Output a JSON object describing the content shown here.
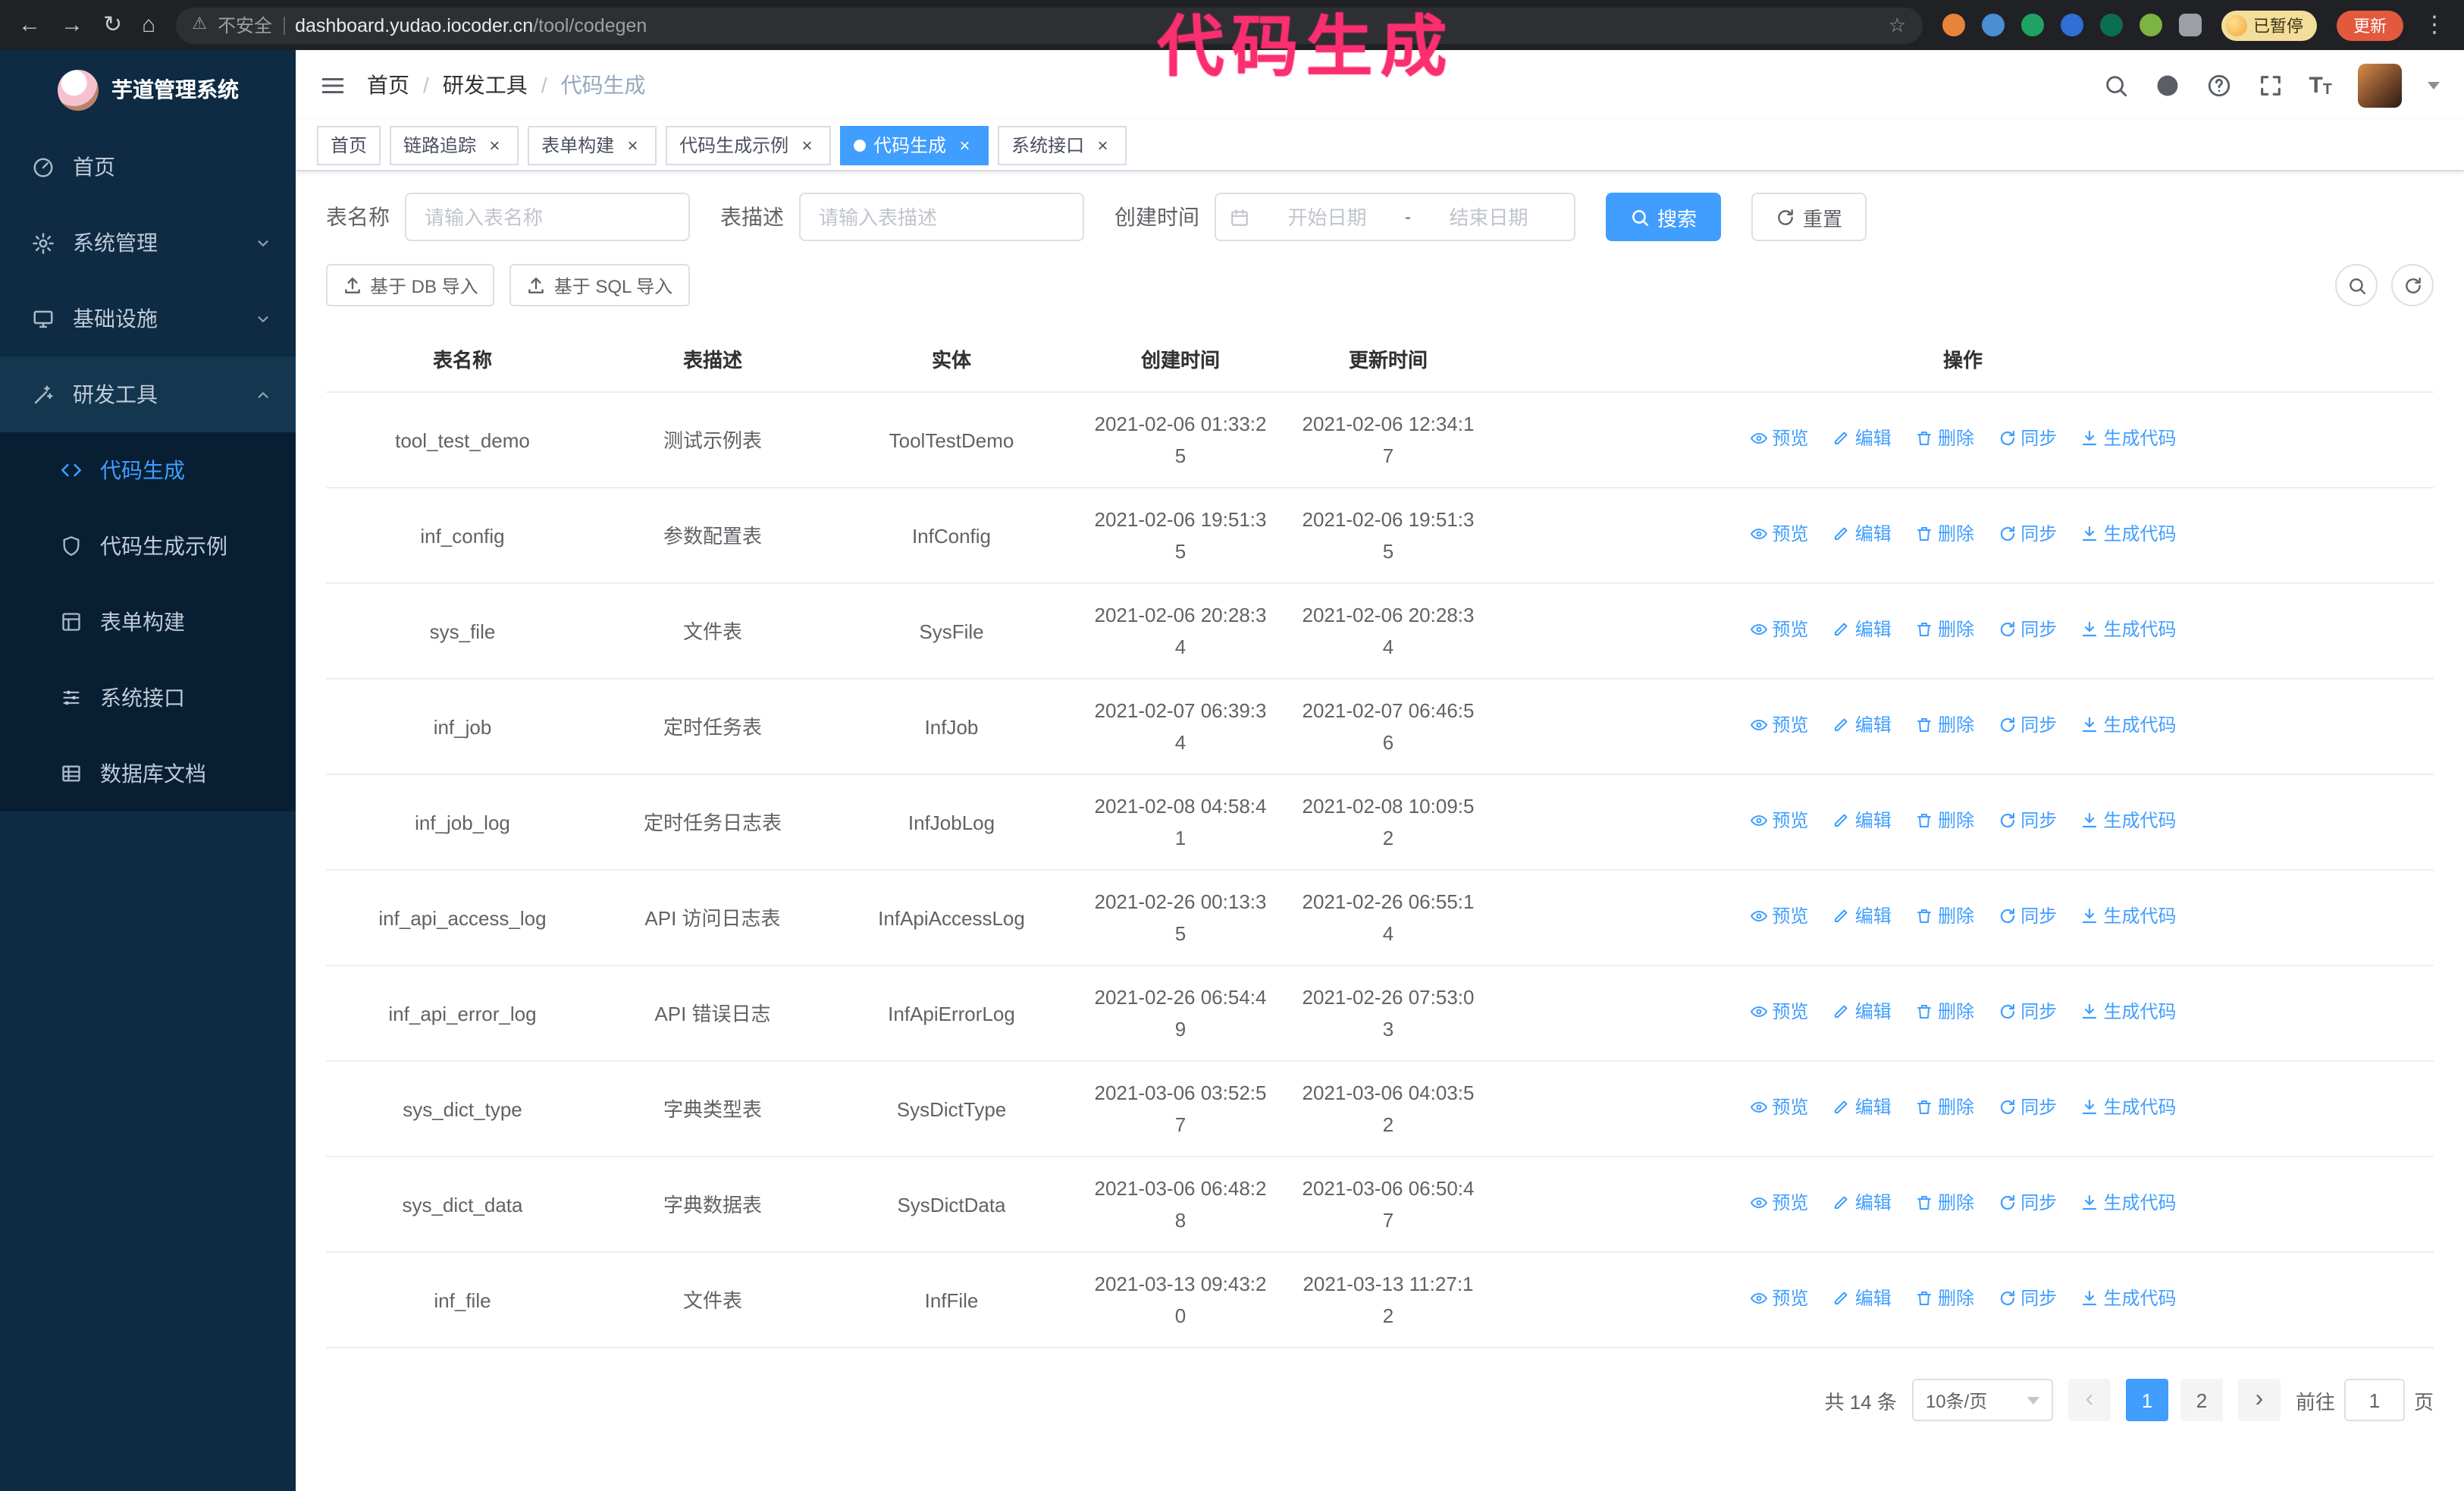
{
  "annotation": {
    "label": "代码生成"
  },
  "icons": {
    "back": "←",
    "forward": "→",
    "reload": "↻",
    "home": "⌂",
    "warning": "⚠",
    "star": "☆",
    "more": "⋮",
    "close": "×",
    "slash": "/",
    "prev": "‹",
    "next": "›",
    "letter_t": "T"
  },
  "browser": {
    "security_label": "不安全",
    "url_host": "dashboard.yudao.iocoder.cn",
    "url_path": "/tool/codegen",
    "profile_badge": "已暂停",
    "update_button": "更新"
  },
  "sidebar": {
    "app_title": "芋道管理系统",
    "items": [
      {
        "label": "首页"
      },
      {
        "label": "系统管理"
      },
      {
        "label": "基础设施"
      },
      {
        "label": "研发工具",
        "expanded": true
      }
    ],
    "submenu": [
      {
        "label": "代码生成",
        "active": true
      },
      {
        "label": "代码生成示例"
      },
      {
        "label": "表单构建"
      },
      {
        "label": "系统接口"
      },
      {
        "label": "数据库文档"
      }
    ]
  },
  "header": {
    "breadcrumb": [
      "首页",
      "研发工具",
      "代码生成"
    ]
  },
  "tabs": [
    {
      "label": "首页",
      "closable": false
    },
    {
      "label": "链路追踪",
      "closable": true
    },
    {
      "label": "表单构建",
      "closable": true
    },
    {
      "label": "代码生成示例",
      "closable": true
    },
    {
      "label": "代码生成",
      "closable": true,
      "active": true
    },
    {
      "label": "系统接口",
      "closable": true
    }
  ],
  "filters": {
    "table_name_label": "表名称",
    "table_name_placeholder": "请输入表名称",
    "table_desc_label": "表描述",
    "table_desc_placeholder": "请输入表描述",
    "create_time_label": "创建时间",
    "start_date_placeholder": "开始日期",
    "end_date_placeholder": "结束日期",
    "range_separator": "-",
    "search_button": "搜索",
    "reset_button": "重置"
  },
  "toolbar": {
    "import_db_button": "基于 DB 导入",
    "import_sql_button": "基于 SQL 导入"
  },
  "table": {
    "columns": [
      "表名称",
      "表描述",
      "实体",
      "创建时间",
      "更新时间",
      "操作"
    ],
    "actions": [
      "预览",
      "编辑",
      "删除",
      "同步",
      "生成代码"
    ],
    "rows": [
      {
        "name": "tool_test_demo",
        "desc": "测试示例表",
        "entity": "ToolTestDemo",
        "created": "2021-02-06 01:33:25",
        "updated": "2021-02-06 12:34:17"
      },
      {
        "name": "inf_config",
        "desc": "参数配置表",
        "entity": "InfConfig",
        "created": "2021-02-06 19:51:35",
        "updated": "2021-02-06 19:51:35"
      },
      {
        "name": "sys_file",
        "desc": "文件表",
        "entity": "SysFile",
        "created": "2021-02-06 20:28:34",
        "updated": "2021-02-06 20:28:34"
      },
      {
        "name": "inf_job",
        "desc": "定时任务表",
        "entity": "InfJob",
        "created": "2021-02-07 06:39:34",
        "updated": "2021-02-07 06:46:56"
      },
      {
        "name": "inf_job_log",
        "desc": "定时任务日志表",
        "entity": "InfJobLog",
        "created": "2021-02-08 04:58:41",
        "updated": "2021-02-08 10:09:52"
      },
      {
        "name": "inf_api_access_log",
        "desc": "API 访问日志表",
        "entity": "InfApiAccessLog",
        "created": "2021-02-26 00:13:35",
        "updated": "2021-02-26 06:55:14"
      },
      {
        "name": "inf_api_error_log",
        "desc": "API 错误日志",
        "entity": "InfApiErrorLog",
        "created": "2021-02-26 06:54:49",
        "updated": "2021-02-26 07:53:03"
      },
      {
        "name": "sys_dict_type",
        "desc": "字典类型表",
        "entity": "SysDictType",
        "created": "2021-03-06 03:52:57",
        "updated": "2021-03-06 04:03:52"
      },
      {
        "name": "sys_dict_data",
        "desc": "字典数据表",
        "entity": "SysDictData",
        "created": "2021-03-06 06:48:28",
        "updated": "2021-03-06 06:50:47"
      },
      {
        "name": "inf_file",
        "desc": "文件表",
        "entity": "InfFile",
        "created": "2021-03-13 09:43:20",
        "updated": "2021-03-13 11:27:12"
      }
    ]
  },
  "pagination": {
    "total": "共 14 条",
    "page_size": "10条/页",
    "pages": [
      {
        "label": "1",
        "active": true
      },
      {
        "label": "2"
      }
    ],
    "goto_label": "前往",
    "goto_value": "1",
    "goto_suffix": "页"
  },
  "colors": {
    "primary": "#409eff",
    "sidebar_bg": "#0e2b43",
    "submenu_bg": "#071e33",
    "annotation": "#fb2e6f",
    "update_chip": "#e2593e"
  }
}
